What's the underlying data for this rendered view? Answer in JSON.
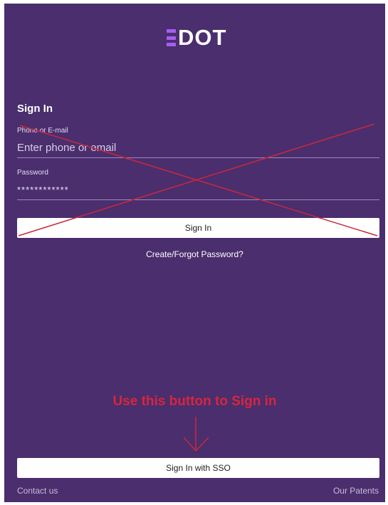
{
  "app": {
    "logo_text": "DOT"
  },
  "signin": {
    "title": "Sign In",
    "phone_label": "Phone or E-mail",
    "phone_placeholder": "Enter phone or email",
    "password_label": "Password",
    "password_value": "************",
    "signin_button": "Sign In",
    "forgot_link": "Create/Forgot Password?"
  },
  "annotation": {
    "text": "Use this button to Sign in",
    "color": "#d7253e"
  },
  "sso": {
    "button_label": "Sign In with SSO"
  },
  "footer": {
    "contact": "Contact us",
    "patents": "Our Patents"
  },
  "colors": {
    "background": "#4a2e6e",
    "logo_accent": "#a55ff0",
    "button": "#ffffff"
  }
}
